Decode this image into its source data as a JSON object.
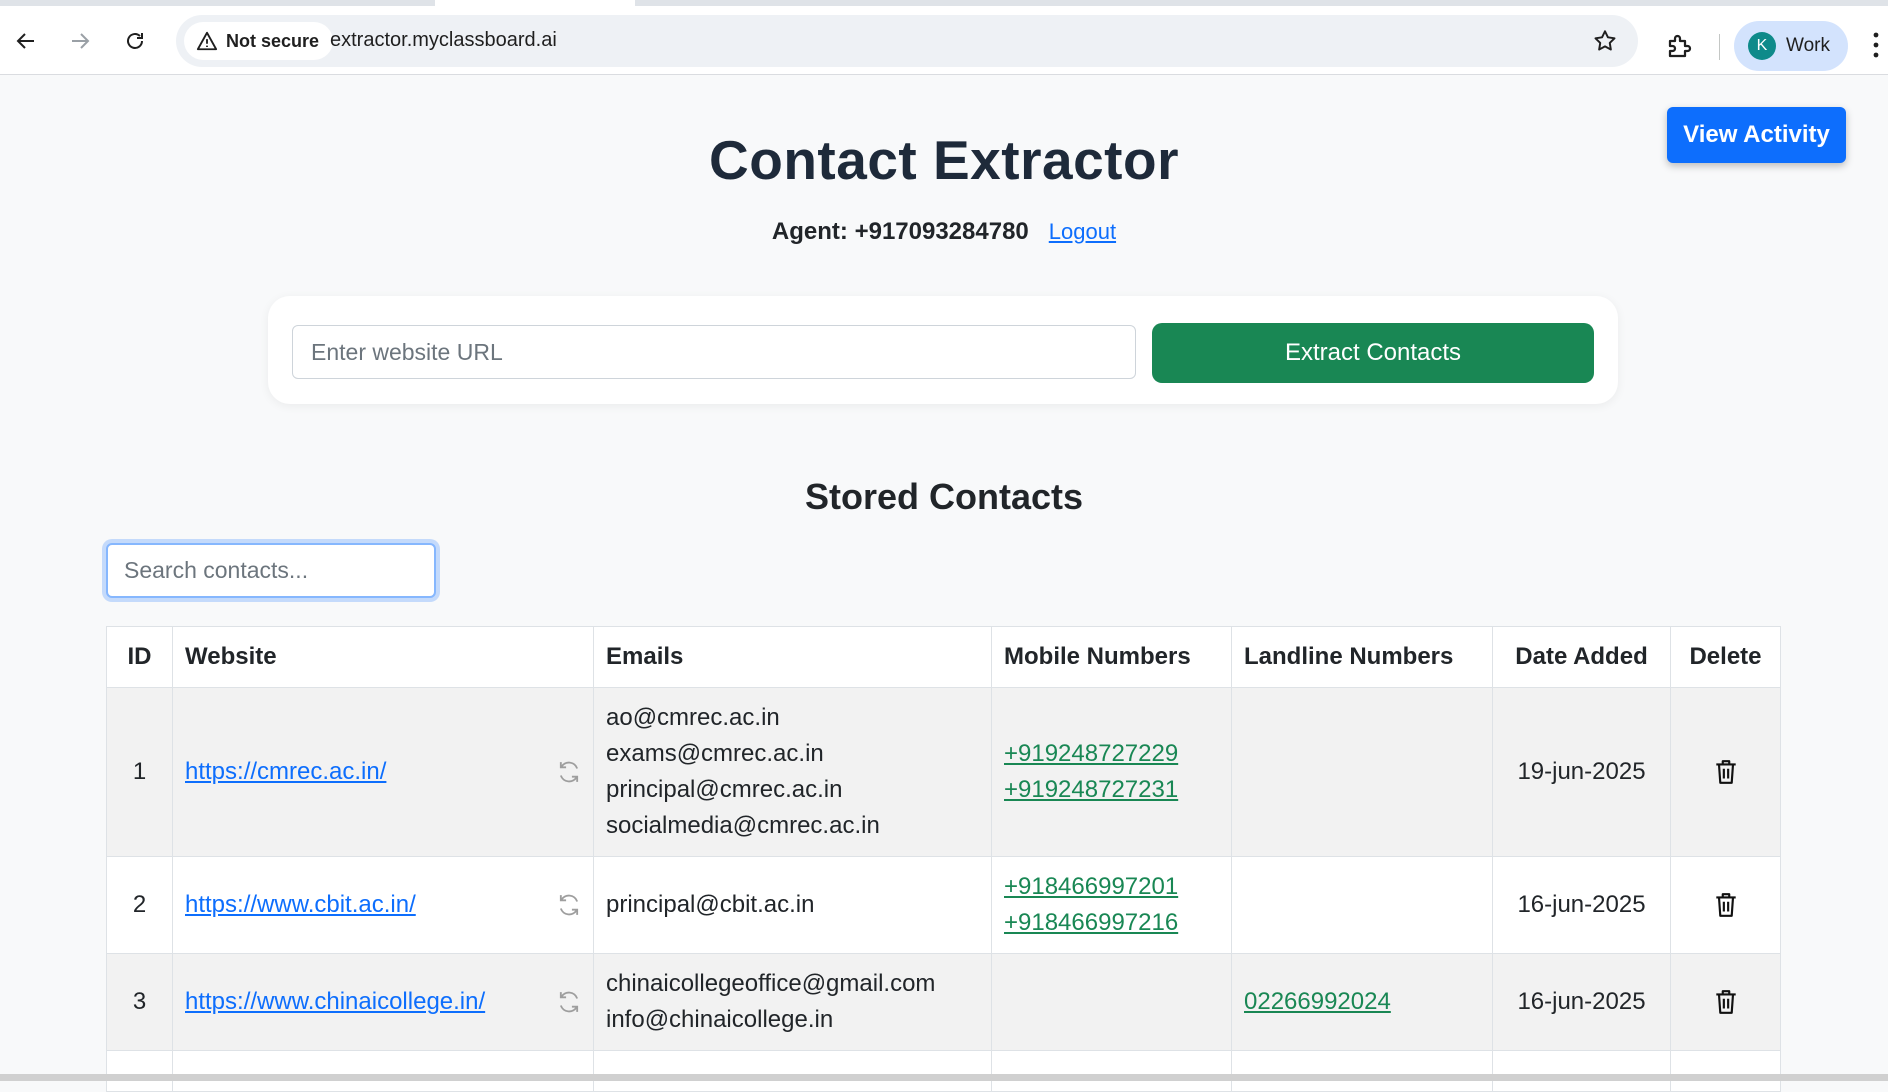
{
  "browser": {
    "security_label": "Not secure",
    "url": "extractor.myclassboard.ai",
    "profile_initial": "K",
    "profile_name": "Work"
  },
  "header": {
    "view_activity_label": "View Activity",
    "title": "Contact Extractor",
    "agent_label": "Agent: +917093284780",
    "logout_label": "Logout"
  },
  "extract": {
    "url_placeholder": "Enter website URL",
    "button_label": "Extract Contacts"
  },
  "stored": {
    "title": "Stored Contacts",
    "search_placeholder": "Search contacts..."
  },
  "table": {
    "columns": [
      "ID",
      "Website",
      "Emails",
      "Mobile Numbers",
      "Landline Numbers",
      "Date Added",
      "Delete"
    ],
    "rows": [
      {
        "id": "1",
        "website": "https://cmrec.ac.in/",
        "emails": [
          "ao@cmrec.ac.in",
          "exams@cmrec.ac.in",
          "principal@cmrec.ac.in",
          "socialmedia@cmrec.ac.in"
        ],
        "mobiles": [
          "+919248727229",
          "+919248727231"
        ],
        "landlines": [],
        "date": "19-jun-2025"
      },
      {
        "id": "2",
        "website": "https://www.cbit.ac.in/",
        "emails": [
          "principal@cbit.ac.in"
        ],
        "mobiles": [
          "+918466997201",
          "+918466997216"
        ],
        "landlines": [],
        "date": "16-jun-2025"
      },
      {
        "id": "3",
        "website": "https://www.chinaicollege.in/",
        "emails": [
          "chinaicollegeoffice@gmail.com",
          "info@chinaicollege.in"
        ],
        "mobiles": [],
        "landlines": [
          "02266992024"
        ],
        "date": "16-jun-2025"
      }
    ]
  },
  "colors": {
    "primary": "#0d6efd",
    "success": "#198754",
    "title": "#1e2a3a"
  }
}
